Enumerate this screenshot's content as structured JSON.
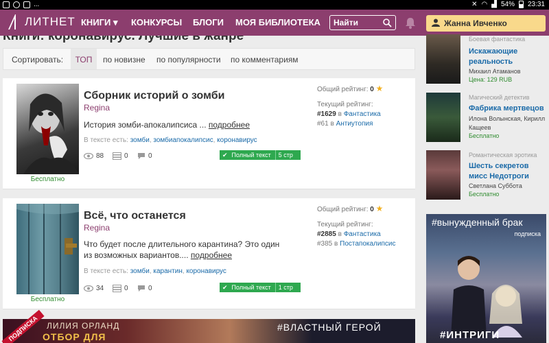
{
  "statusbar": {
    "dots": "...",
    "battery": "54%",
    "time": "23:31"
  },
  "nav": {
    "logo": "ЛИТНЕТ",
    "items": [
      "КНИГИ",
      "КОНКУРСЫ",
      "БЛОГИ",
      "МОЯ БИБЛИОТЕКА"
    ],
    "search": "Найти",
    "user": "Жанна Ивченко"
  },
  "heading": "Книги: коронавирус. Лучшие в жанре",
  "sort": {
    "label": "Сортировать:",
    "active": "ТОП",
    "options": [
      "по новизне",
      "по популярности",
      "по комментариям"
    ]
  },
  "books": [
    {
      "title": "Сборник историй о зомби",
      "author": "Regina",
      "annotation": "История зомби-апокалипсиса ...",
      "more": "подробнее",
      "tags_label": "В тексте есть:",
      "tags": [
        "зомби",
        "зомбиапокалипсис",
        "коронавирус"
      ],
      "views": "88",
      "libs": "0",
      "comments": "0",
      "fulltext": "Полный текст",
      "pages": "5 стр",
      "price": "Бесплатно",
      "overall_label": "Общий рейтинг:",
      "overall": "0",
      "current_label": "Текущий рейтинг:",
      "rank1": "#1629",
      "genre1": "Фантастика",
      "rank2": "#61",
      "genre2": "Антиутопия"
    },
    {
      "title": "Всё, что останется",
      "author": "Regina",
      "annotation": "Что будет после длительного карантина? Это один из возможных вариантов....",
      "more": "подробнее",
      "tags_label": "В тексте есть:",
      "tags": [
        "зомби",
        "карантин",
        "коронавирус"
      ],
      "views": "34",
      "libs": "0",
      "comments": "0",
      "fulltext": "Полный текст",
      "pages": "1 стр",
      "price": "Бесплатно",
      "overall_label": "Общий рейтинг:",
      "overall": "0",
      "current_label": "Текущий рейтинг:",
      "rank1": "#2885",
      "genre1": "Фантастика",
      "rank2": "#385",
      "genre2": "Постапокалипсис"
    }
  ],
  "sidebar": [
    {
      "category": "Боевая фантастика",
      "title": "Искажающие реальность",
      "author": "Михаил Атаманов",
      "price": "Цена: 129 RUB"
    },
    {
      "category": "Магический детектив",
      "title": "Фабрика мертвецов",
      "author": "Илона Волынская, Кирилл Кащеев",
      "price": "Бесплатно"
    },
    {
      "category": "Романтическая эротика",
      "title": "Шесть секретов мисс Недотроги",
      "author": "Светлана Субботa",
      "price": "Бесплатно"
    }
  ],
  "ads": {
    "right_tag": "#вынужденный брак",
    "right_sub": "подписка",
    "right_bottom": "#ИНТРИГИ",
    "bottom_left_badge": "ПОДПИСКА",
    "bottom_author": "ЛИЛИЯ ОРЛАНД",
    "bottom_title": "ОТБОР ДЛЯ",
    "bottom_tag": "#ВЛАСТНЫЙ ГЕРОЙ"
  }
}
